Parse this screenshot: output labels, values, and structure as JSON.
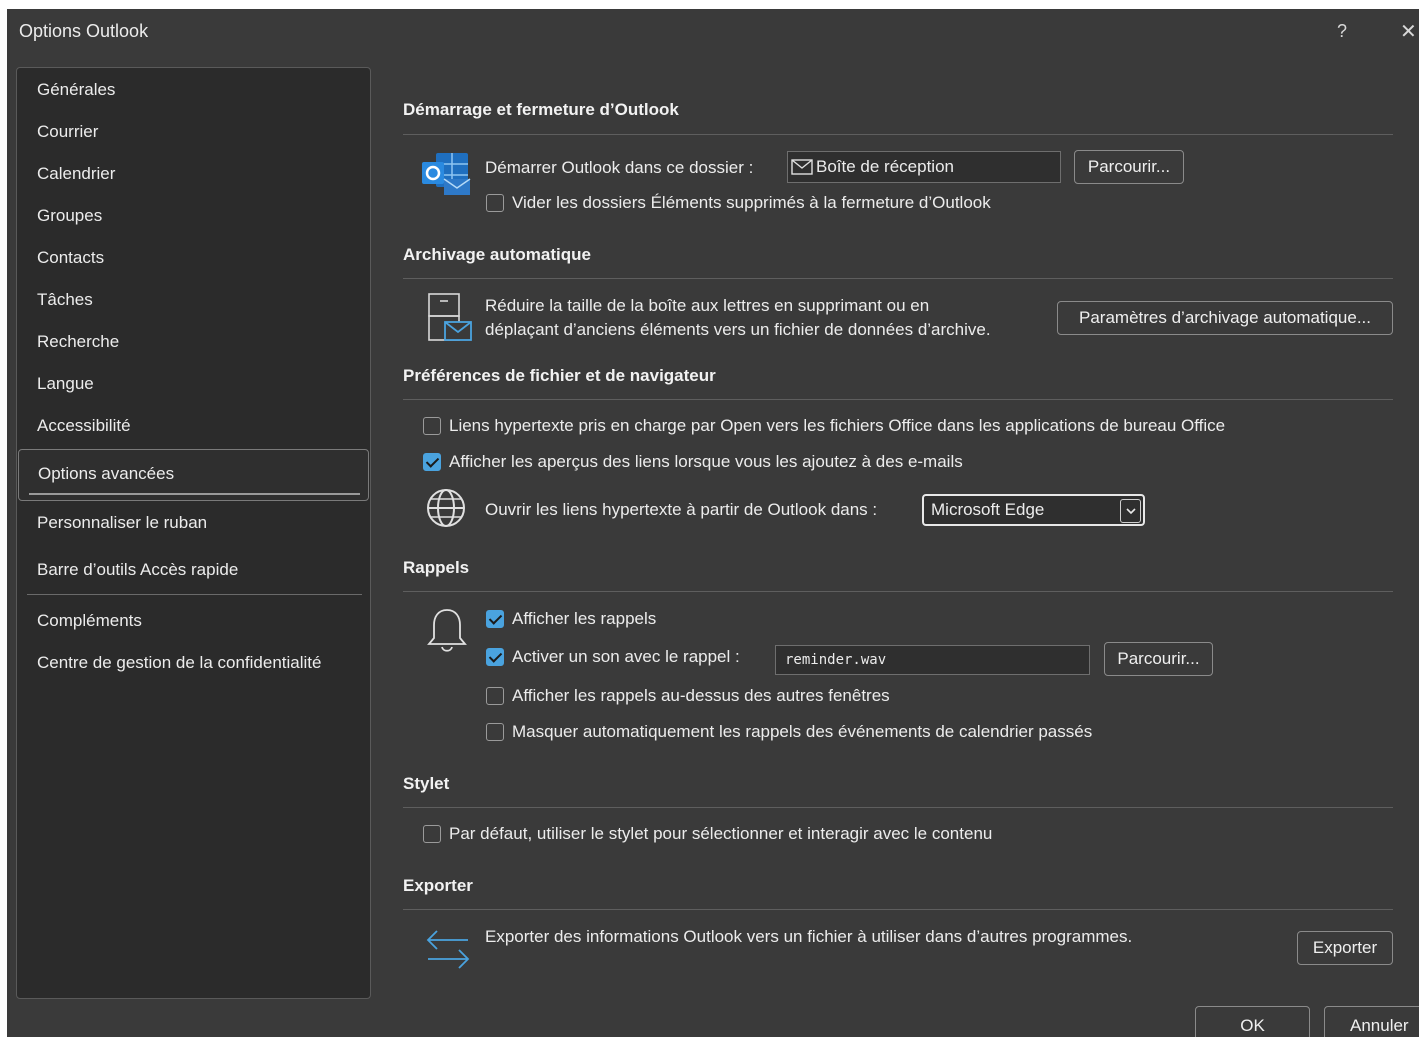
{
  "window": {
    "title": "Options Outlook",
    "help": "?",
    "close": "✕"
  },
  "sidebar": {
    "items": [
      "Générales",
      "Courrier",
      "Calendrier",
      "Groupes",
      "Contacts",
      "Tâches",
      "Recherche",
      "Langue",
      "Accessibilité",
      "Options avancées",
      "Personnaliser le ruban",
      "Barre d’outils Accès rapide",
      "Compléments",
      "Centre de gestion de la confidentialité"
    ],
    "selected": "Options avancées"
  },
  "sections": {
    "startup": {
      "title": "Démarrage et fermeture d’Outlook",
      "start_label": "Démarrer Outlook dans ce dossier :",
      "folder_value": "Boîte de réception",
      "browse": "Parcourir...",
      "empty_deleted": {
        "label": "Vider les dossiers Éléments supprimés à la fermeture d’Outlook",
        "checked": false
      }
    },
    "autoarchive": {
      "title": "Archivage automatique",
      "desc_line1": "Réduire la taille de la boîte aux lettres en supprimant ou en",
      "desc_line2": "déplaçant d’anciens éléments vers un fichier de données d’archive.",
      "button": "Paramètres d’archivage automatique..."
    },
    "browser": {
      "title": "Préférences de fichier et de navigateur",
      "open_links": {
        "label": "Liens hypertexte pris en charge par Open vers les fichiers Office dans les applications de bureau Office",
        "checked": false
      },
      "link_previews": {
        "label": "Afficher les aperçus des liens lorsque vous les ajoutez à des e-mails",
        "checked": true
      },
      "open_in_label": "Ouvrir les liens hypertexte à partir de Outlook dans :",
      "browser_value": "Microsoft Edge"
    },
    "reminders": {
      "title": "Rappels",
      "show": {
        "label": "Afficher les rappels",
        "checked": true
      },
      "sound": {
        "label": "Activer un son avec le rappel :",
        "checked": true
      },
      "sound_file": "reminder.wav",
      "browse": "Parcourir...",
      "on_top": {
        "label": "Afficher les rappels au-dessus des autres fenêtres",
        "checked": false
      },
      "auto_dismiss": {
        "label": "Masquer automatiquement les rappels des événements de calendrier passés",
        "checked": false
      }
    },
    "pen": {
      "title": "Stylet",
      "use_pen": {
        "label": "Par défaut, utiliser le stylet pour sélectionner et interagir avec le contenu",
        "checked": false
      }
    },
    "export": {
      "title": "Exporter",
      "desc": "Exporter des informations Outlook vers un fichier à utiliser dans d’autres programmes.",
      "button": "Exporter"
    }
  },
  "footer": {
    "ok": "OK",
    "cancel": "Annuler"
  },
  "colors": {
    "accent": "#4aa3df",
    "background": "#3a3a3a",
    "sidebar": "#2b2b2b"
  }
}
